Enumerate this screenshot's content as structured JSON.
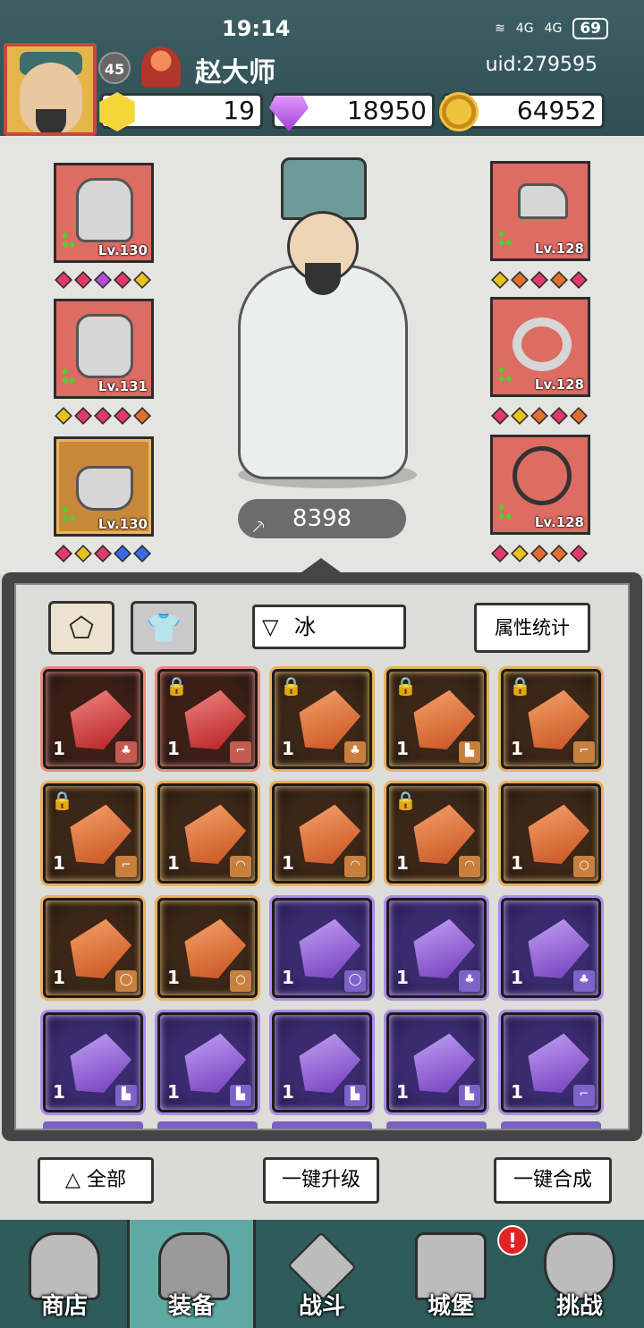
{
  "status_bar": {
    "time": "19:14",
    "network1": "4G",
    "network2": "4G",
    "battery": "69"
  },
  "player": {
    "level": "45",
    "name": "赵大师",
    "uid": "uid:279595"
  },
  "currencies": {
    "gold": "19",
    "gems": "18950",
    "coins": "64952"
  },
  "equipment": {
    "left": [
      {
        "name": "helmet",
        "level": "Lv.130",
        "frame": "red",
        "diamonds": [
          "#e03a6a",
          "#e03a6a",
          "#b34ed8",
          "#e03a6a",
          "#e8c020"
        ]
      },
      {
        "name": "armor",
        "level": "Lv.131",
        "frame": "red",
        "diamonds": [
          "#e8c020",
          "#e03a6a",
          "#e03a6a",
          "#e03a6a",
          "#e07030"
        ]
      },
      {
        "name": "boots",
        "level": "Lv.130",
        "frame": "gold",
        "diamonds": [
          "#e03a6a",
          "#e8c020",
          "#e03a6a",
          "#3a6ae0",
          "#3a6ae0"
        ]
      }
    ],
    "right": [
      {
        "name": "gloves",
        "level": "Lv.128",
        "frame": "red",
        "diamonds": [
          "#e8c020",
          "#e07030",
          "#e03a6a",
          "#e07030",
          "#e03a6a"
        ]
      },
      {
        "name": "ring",
        "level": "Lv.128",
        "frame": "red",
        "diamonds": [
          "#e03a6a",
          "#e8c020",
          "#e07030",
          "#e03a6a",
          "#e07030"
        ]
      },
      {
        "name": "necklace",
        "level": "Lv.128",
        "frame": "red",
        "diamonds": [
          "#e03a6a",
          "#e8c020",
          "#e07030",
          "#e07030",
          "#e03a6a"
        ]
      }
    ],
    "power": "8398"
  },
  "inventory": {
    "filter_label": "冰",
    "stats_button": "属性统计",
    "items": [
      {
        "rarity": "red",
        "qty": "1",
        "locked": false,
        "type": "armor-icon",
        "glyph": "♣"
      },
      {
        "rarity": "red",
        "qty": "1",
        "locked": true,
        "type": "gloves-icon",
        "glyph": "⌐"
      },
      {
        "rarity": "orange",
        "qty": "1",
        "locked": true,
        "type": "armor-icon",
        "glyph": "♣"
      },
      {
        "rarity": "orange",
        "qty": "1",
        "locked": true,
        "type": "boots-icon",
        "glyph": "▙"
      },
      {
        "rarity": "orange",
        "qty": "1",
        "locked": true,
        "type": "gloves-icon",
        "glyph": "⌐"
      },
      {
        "rarity": "orange",
        "qty": "1",
        "locked": true,
        "type": "gloves-icon",
        "glyph": "⌐"
      },
      {
        "rarity": "orange",
        "qty": "1",
        "locked": false,
        "type": "helmet-icon",
        "glyph": "◠"
      },
      {
        "rarity": "orange",
        "qty": "1",
        "locked": false,
        "type": "helmet-icon",
        "glyph": "◠"
      },
      {
        "rarity": "orange",
        "qty": "1",
        "locked": true,
        "type": "helmet-icon",
        "glyph": "◠"
      },
      {
        "rarity": "orange",
        "qty": "1",
        "locked": false,
        "type": "necklace-icon",
        "glyph": "○"
      },
      {
        "rarity": "orange",
        "qty": "1",
        "locked": false,
        "type": "ring-icon",
        "glyph": "◯"
      },
      {
        "rarity": "orange",
        "qty": "1",
        "locked": false,
        "type": "necklace-icon",
        "glyph": "○"
      },
      {
        "rarity": "purple",
        "qty": "1",
        "locked": false,
        "type": "ring-icon",
        "glyph": "◯"
      },
      {
        "rarity": "purple",
        "qty": "1",
        "locked": false,
        "type": "armor-icon",
        "glyph": "♣"
      },
      {
        "rarity": "purple",
        "qty": "1",
        "locked": false,
        "type": "armor-icon",
        "glyph": "♣"
      },
      {
        "rarity": "purple",
        "qty": "1",
        "locked": false,
        "type": "boots-icon",
        "glyph": "▙"
      },
      {
        "rarity": "purple",
        "qty": "1",
        "locked": false,
        "type": "boots-icon",
        "glyph": "▙"
      },
      {
        "rarity": "purple",
        "qty": "1",
        "locked": false,
        "type": "boots-icon",
        "glyph": "▙"
      },
      {
        "rarity": "purple",
        "qty": "1",
        "locked": false,
        "type": "boots-icon",
        "glyph": "▙"
      },
      {
        "rarity": "purple",
        "qty": "1",
        "locked": false,
        "type": "gloves-icon",
        "glyph": "⌐"
      }
    ]
  },
  "actions": {
    "all": "全部",
    "upgrade_all": "一键升级",
    "merge_all": "一键合成"
  },
  "nav": [
    {
      "id": "shop",
      "label": "商店",
      "active": false
    },
    {
      "id": "equipment",
      "label": "装备",
      "active": true
    },
    {
      "id": "battle",
      "label": "战斗",
      "active": false
    },
    {
      "id": "castle",
      "label": "城堡",
      "active": false
    },
    {
      "id": "challenge",
      "label": "挑战",
      "active": false
    }
  ],
  "notification_badge": "!"
}
